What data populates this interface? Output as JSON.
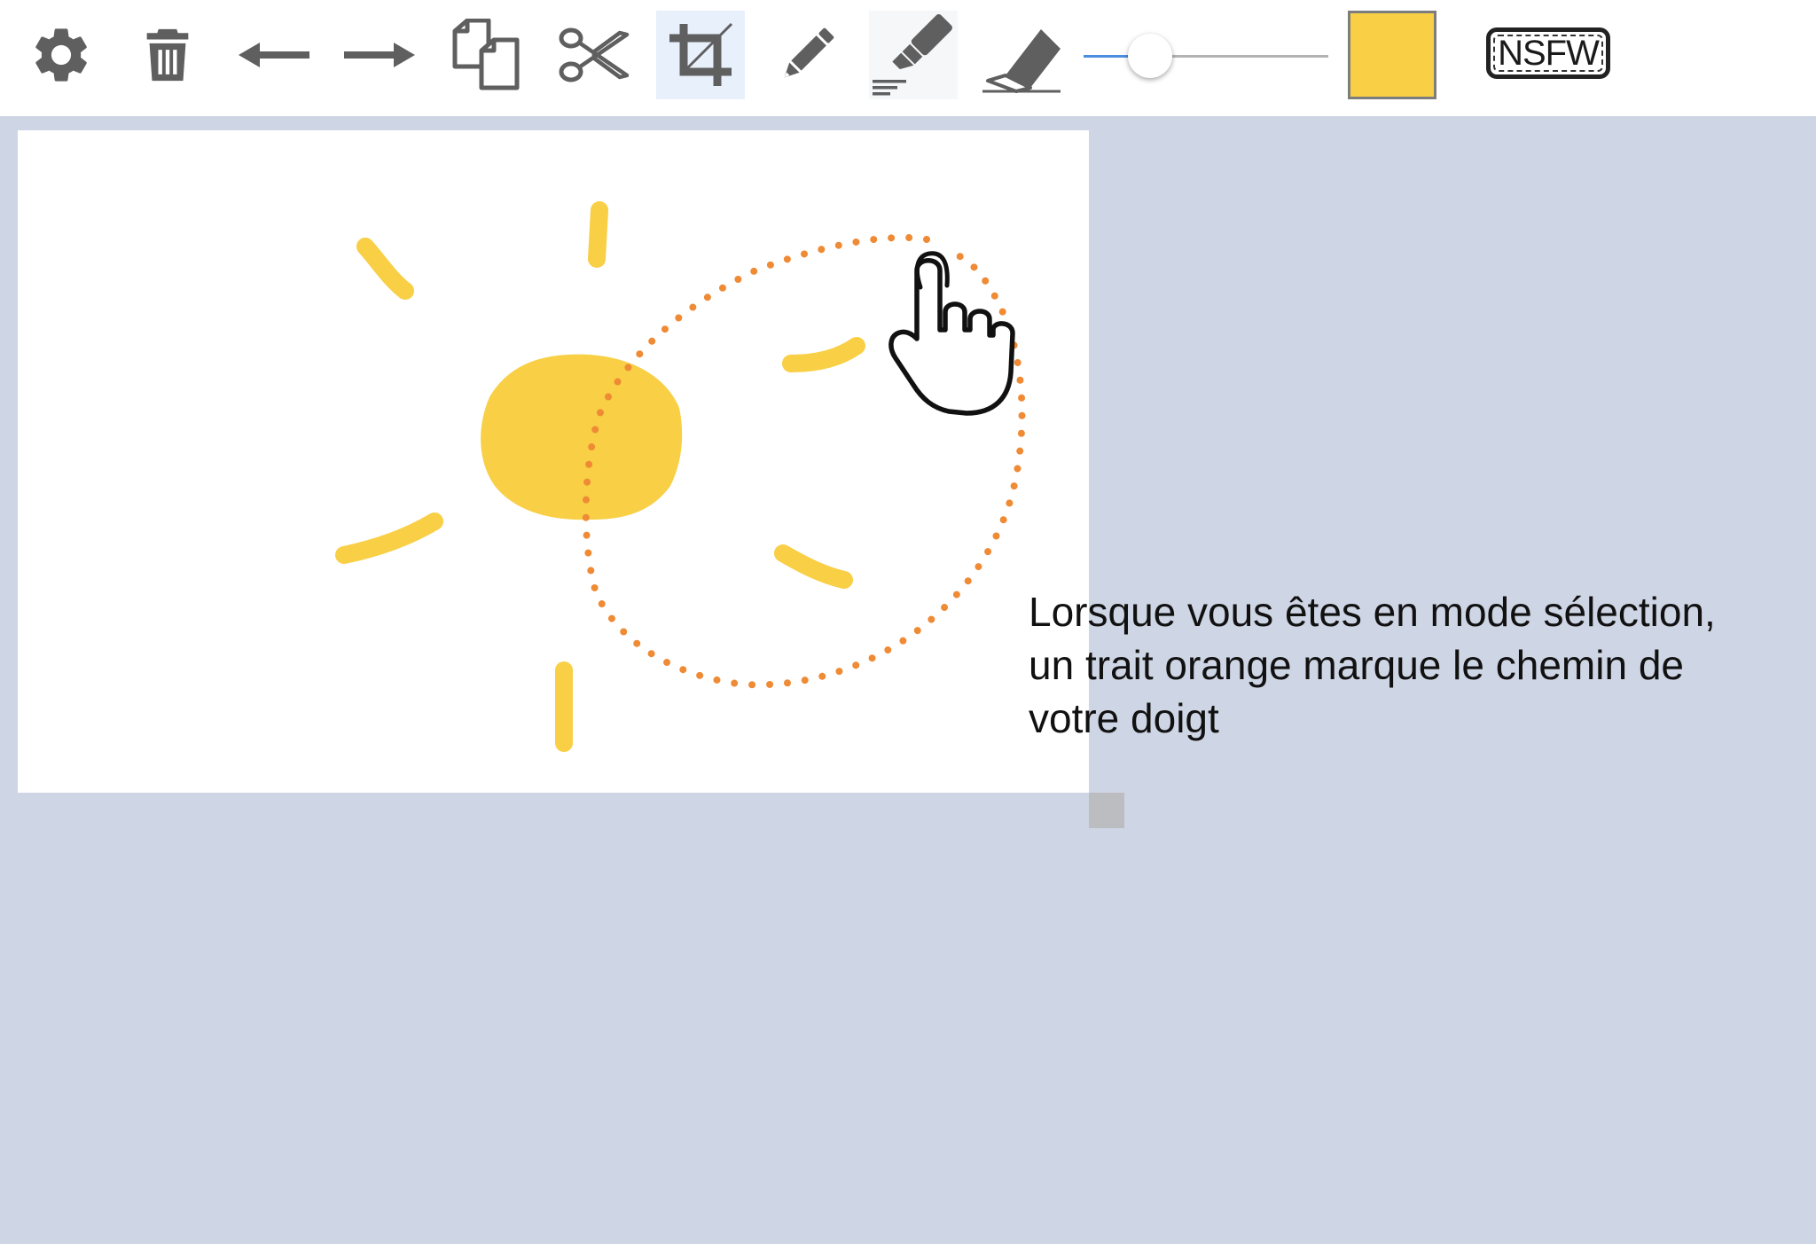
{
  "toolbar": {
    "tools": [
      {
        "icon": "gear-icon",
        "state": "default"
      },
      {
        "icon": "trash-icon",
        "state": "default"
      },
      {
        "icon": "arrow-left-icon",
        "state": "default"
      },
      {
        "icon": "arrow-right-icon",
        "state": "default"
      },
      {
        "icon": "copy-icon",
        "state": "default"
      },
      {
        "icon": "scissors-icon",
        "state": "default"
      },
      {
        "icon": "crop-icon",
        "state": "active"
      },
      {
        "icon": "pencil-icon",
        "state": "default"
      },
      {
        "icon": "marker-icon",
        "state": "highlighted"
      },
      {
        "icon": "eraser-icon",
        "state": "default"
      }
    ],
    "brush_size_fraction": 0.27,
    "current_color": "#f8cf45",
    "nsfw_label": "NSFW"
  },
  "colors": {
    "toolbar_bg": "#ffffff",
    "workspace_bg": "#ced5e4",
    "icon": "#5f5f5f",
    "active_tool_bg": "#e8f0fc",
    "stroke_yellow": "#f8cf45",
    "selection_path": "#ef8a35",
    "slider_fill": "#4b8ee0"
  },
  "canvas": {
    "drawing": "sun",
    "selection_path_style": "dotted",
    "cursor_icon": "hand-pointer-icon"
  },
  "tutorial": {
    "text": "Lorsque vous êtes en mode sélection, un trait orange marque le chemin de votre doigt"
  }
}
